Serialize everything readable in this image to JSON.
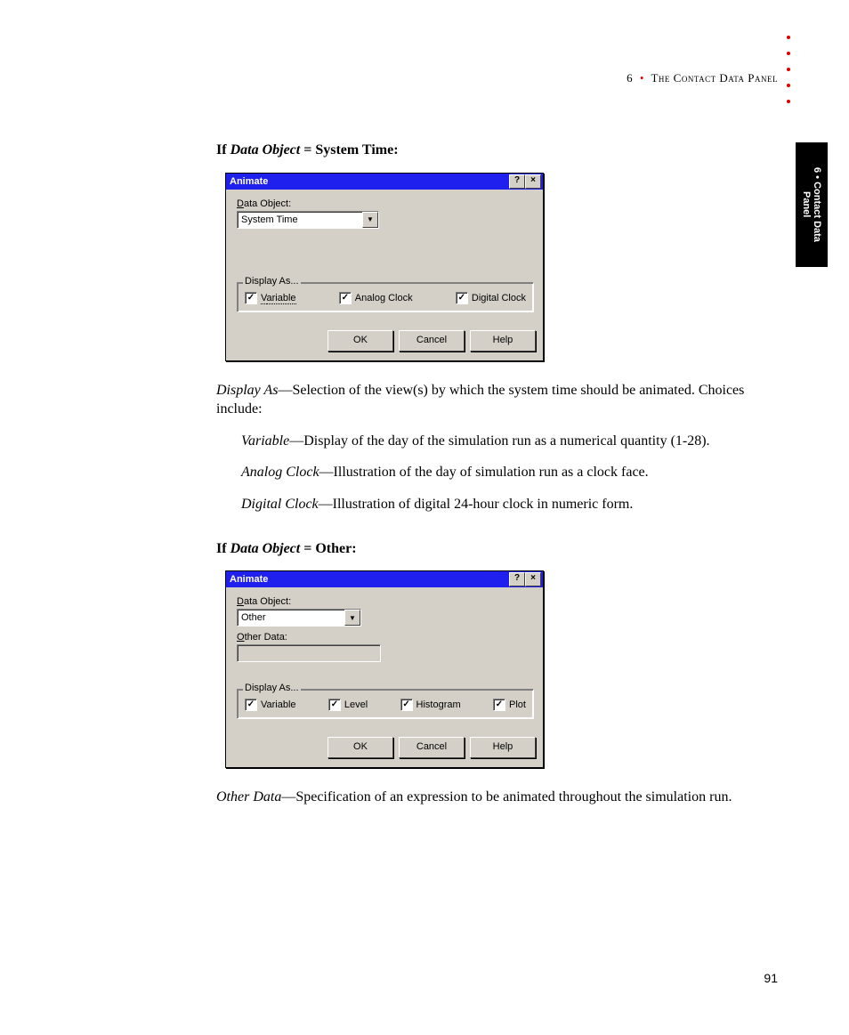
{
  "header": {
    "num": "6",
    "title": "The Contact Data Panel"
  },
  "sideTab": "6 • Contact Data Panel",
  "pageNumber": "91",
  "text": {
    "h1_a": "If ",
    "h1_b": "Data Object",
    "h1_c": " = System Time:",
    "p1_a": "Display As",
    "p1_b": "—Selection of the view(s) by which the system time should be animated. Choices include:",
    "li1_a": "Variable",
    "li1_b": "—Display of the day of the simulation run as a numerical quantity (1-28).",
    "li2_a": "Analog Clock",
    "li2_b": "—Illustration of the day of simulation run as a clock face.",
    "li3_a": "Digital Clock",
    "li3_b": "—Illustration of digital 24-hour clock in numeric form.",
    "h2_a": "If ",
    "h2_b": "Data Object",
    "h2_c": " = Other:",
    "p2_a": "Other Data",
    "p2_b": "—Specification of an expression to be animated throughout the simulation run."
  },
  "dialog1": {
    "title": "Animate",
    "dataObjectLabel_u": "D",
    "dataObjectLabel_r": "ata Object:",
    "dataObjectValue": "System Time",
    "groupLabel": "Display As...",
    "cb1_u": "V",
    "cb1_r": "ariable",
    "cb2_u": "A",
    "cb2_r": "nalog Clock",
    "cb3_u": "D",
    "cb3_r": "igital Clock",
    "ok": "OK",
    "cancel": "Cancel",
    "help_u": "H",
    "help_r": "elp"
  },
  "dialog2": {
    "title": "Animate",
    "dataObjectLabel_u": "D",
    "dataObjectLabel_r": "ata Object:",
    "dataObjectValue": "Other",
    "otherDataLabel_u": "O",
    "otherDataLabel_r": "ther Data:",
    "groupLabel": "Display As...",
    "cb1_u": "V",
    "cb1_r": "ariable",
    "cb2_u": "L",
    "cb2_r": "evel",
    "cb3_u": "H",
    "cb3_r": "istogram",
    "cb4_u": "P",
    "cb4_r": "lot",
    "ok": "OK",
    "cancel": "Cancel",
    "help_u": "H",
    "help_r": "elp"
  }
}
